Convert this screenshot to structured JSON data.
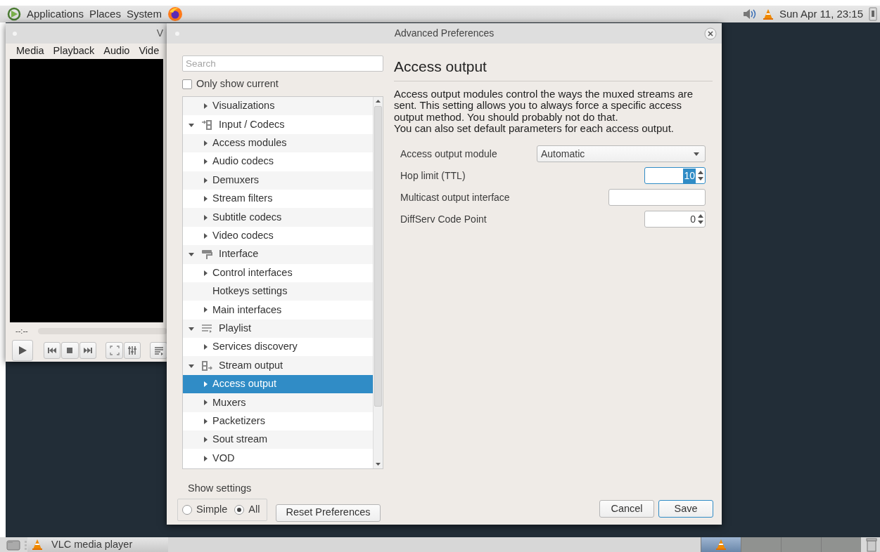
{
  "top_panel": {
    "menus": [
      "Applications",
      "Places",
      "System"
    ],
    "clock": "Sun Apr 11, 23:15"
  },
  "player_window": {
    "title": "V",
    "menus": [
      "Media",
      "Playback",
      "Audio",
      "Vide"
    ],
    "time": "--:--"
  },
  "dialog": {
    "title": "Advanced Preferences",
    "search": {
      "placeholder": "Search"
    },
    "only_show_current": {
      "label": "Only show current",
      "checked": false
    },
    "tree": [
      {
        "children": [
          {
            "label": "Visualizations",
            "has_children": true,
            "expanded": false,
            "selected": false
          }
        ]
      },
      {
        "label": "Input / Codecs",
        "has_children": true,
        "expanded": true,
        "selected": false,
        "children": [
          {
            "label": "Access modules",
            "has_children": true,
            "expanded": false,
            "selected": false
          },
          {
            "label": "Audio codecs",
            "has_children": true,
            "expanded": false,
            "selected": false
          },
          {
            "label": "Demuxers",
            "has_children": true,
            "expanded": false,
            "selected": false
          },
          {
            "label": "Stream filters",
            "has_children": true,
            "expanded": false,
            "selected": false
          },
          {
            "label": "Subtitle codecs",
            "has_children": true,
            "expanded": false,
            "selected": false
          },
          {
            "label": "Video codecs",
            "has_children": true,
            "expanded": false,
            "selected": false
          }
        ]
      },
      {
        "label": "Interface",
        "has_children": true,
        "expanded": true,
        "selected": false,
        "children": [
          {
            "label": "Control interfaces",
            "has_children": true,
            "expanded": false,
            "selected": false
          },
          {
            "label": "Hotkeys settings",
            "has_children": false,
            "expanded": false,
            "selected": false
          },
          {
            "label": "Main interfaces",
            "has_children": true,
            "expanded": false,
            "selected": false
          }
        ]
      },
      {
        "label": "Playlist",
        "has_children": true,
        "expanded": true,
        "selected": false,
        "children": [
          {
            "label": "Services discovery",
            "has_children": true,
            "expanded": false,
            "selected": false
          }
        ]
      },
      {
        "label": "Stream output",
        "has_children": true,
        "expanded": true,
        "selected": false,
        "children": [
          {
            "label": "Access output",
            "has_children": true,
            "expanded": false,
            "selected": true
          },
          {
            "label": "Muxers",
            "has_children": true,
            "expanded": false,
            "selected": false
          },
          {
            "label": "Packetizers",
            "has_children": true,
            "expanded": false,
            "selected": false
          },
          {
            "label": "Sout stream",
            "has_children": true,
            "expanded": false,
            "selected": false
          },
          {
            "label": "VOD",
            "has_children": true,
            "expanded": false,
            "selected": false
          }
        ]
      }
    ],
    "section_title": "Access output",
    "description": [
      "Access output modules control the ways the muxed streams are sent. This setting allows you to always force a specific access output method. You should probably not do that.",
      "You can also set default parameters for each access output."
    ],
    "settings": [
      {
        "kind": "dropdown",
        "label": "Access output module",
        "value": "Automatic",
        "focused": false
      },
      {
        "kind": "spinbox",
        "label": "Hop limit (TTL)",
        "value": "10",
        "focused": true
      },
      {
        "kind": "text",
        "label": "Multicast output interface",
        "focused": false
      },
      {
        "kind": "spinbox",
        "label": "DiffServ Code Point",
        "value": "0",
        "focused": false
      }
    ],
    "show_settings": {
      "label": "Show settings",
      "options": [
        {
          "label": "Simple",
          "selected": false
        },
        {
          "label": "All",
          "selected": true
        }
      ]
    },
    "buttons": [
      {
        "label": "Reset Preferences",
        "default": false
      },
      {
        "label": "Cancel",
        "default": false
      },
      {
        "label": "Save",
        "default": true
      }
    ]
  },
  "taskbar": {
    "tasks": [
      "VLC media player"
    ],
    "workspaces": [
      {
        "selected": true
      },
      {
        "selected": false
      },
      {
        "selected": false
      },
      {
        "selected": false
      }
    ]
  }
}
